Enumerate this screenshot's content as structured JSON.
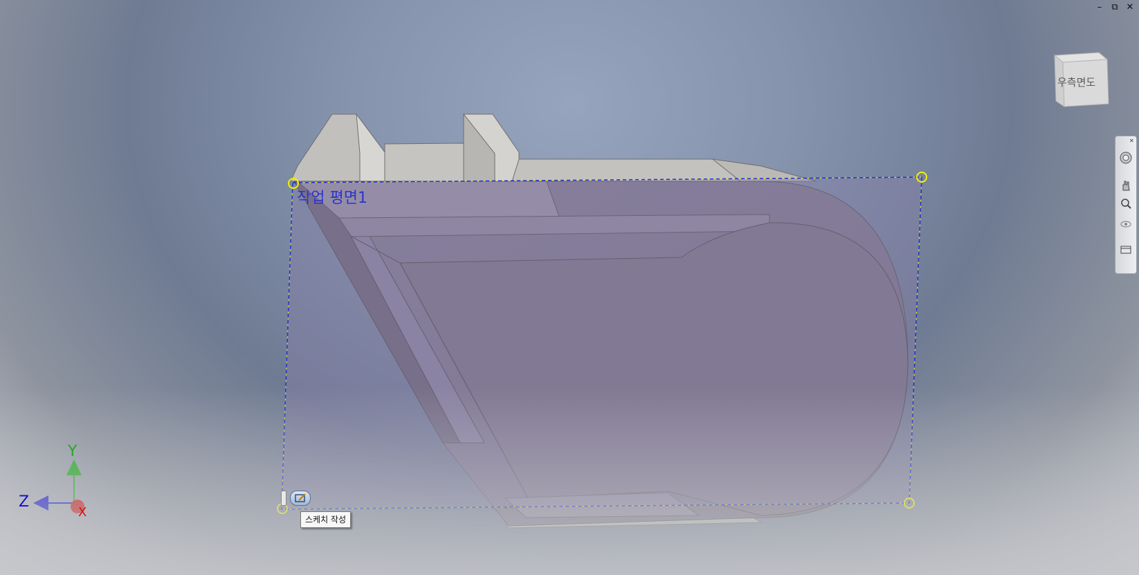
{
  "window": {
    "minimize_icon": "minimize-icon",
    "restore_icon": "restore-icon",
    "close_icon": "close-icon",
    "minimize_glyph": "–",
    "restore_glyph": "⧉",
    "close_glyph": "✕"
  },
  "viewcube": {
    "face_label": "우측면도"
  },
  "navigation_bar": {
    "tools": [
      "steering-wheel-icon",
      "pan-icon",
      "zoom-icon",
      "orbit-icon",
      "look-at-icon"
    ]
  },
  "workplane": {
    "name": "작업 평면1"
  },
  "tooltip": {
    "text": "스케치 작성"
  },
  "axes": {
    "y_label": "Y",
    "z_label": "Z",
    "x_label": "X"
  },
  "colors": {
    "plane_border": "#2233cc",
    "plane_handle": "#f2f200",
    "plane_fill": "#8a7ea8",
    "axis_x": "#cc1111",
    "axis_y": "#22aa22",
    "axis_z": "#1111cc"
  }
}
